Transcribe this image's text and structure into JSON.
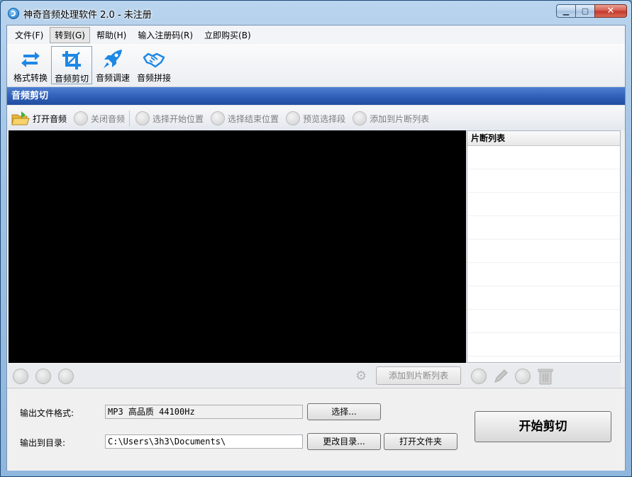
{
  "window": {
    "title": "神奇音频处理软件 2.0 - 未注册"
  },
  "menu": [
    {
      "label": "文件(F)",
      "active": false
    },
    {
      "label": "转到(G)",
      "active": true
    },
    {
      "label": "帮助(H)",
      "active": false
    },
    {
      "label": "输入注册码(R)",
      "active": false
    },
    {
      "label": "立即购买(B)",
      "active": false
    }
  ],
  "toolbar": [
    {
      "label": "格式转换",
      "icon": "convert-icon",
      "active": false
    },
    {
      "label": "音频剪切",
      "icon": "crop-icon",
      "active": true
    },
    {
      "label": "音频调速",
      "icon": "rocket-icon",
      "active": false
    },
    {
      "label": "音频拼接",
      "icon": "handshake-icon",
      "active": false
    }
  ],
  "section": {
    "title": "音频剪切"
  },
  "subtoolbar": [
    {
      "label": "打开音频",
      "enabled": true
    },
    {
      "label": "关闭音频",
      "enabled": false
    },
    {
      "label": "选择开始位置",
      "enabled": false
    },
    {
      "label": "选择结束位置",
      "enabled": false
    },
    {
      "label": "预览选择段",
      "enabled": false
    },
    {
      "label": "添加到片断列表",
      "enabled": false
    }
  ],
  "segment_list": {
    "header": "片断列表"
  },
  "controls": {
    "add_to_list_button": "添加到片断列表"
  },
  "output": {
    "format_label": "输出文件格式:",
    "format_value": "MP3 高品质 44100Hz",
    "choose_button": "选择...",
    "dir_label": "输出到目录:",
    "dir_value": "C:\\Users\\3h3\\Documents\\",
    "change_dir_button": "更改目录...",
    "open_folder_button": "打开文件夹"
  },
  "start_button": "开始剪切",
  "colors": {
    "section_bar": "#2f5fb8",
    "accent_blue": "#1e88e5",
    "video_bg": "#000000"
  }
}
